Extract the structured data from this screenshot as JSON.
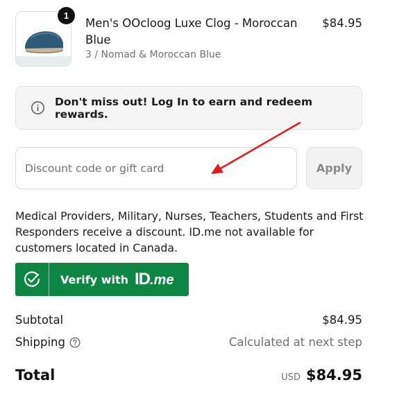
{
  "cart_item": {
    "quantity": "1",
    "name": "Men's OOcloog Luxe Clog - Moroccan Blue",
    "variant": "3 / Nomad & Moroccan Blue",
    "price": "$84.95",
    "image_icon": "blue-clog-shoe"
  },
  "login_banner": {
    "icon": "info-icon",
    "text": "Don't miss out! Log In to earn and redeem rewards."
  },
  "discount": {
    "placeholder": "Discount code or gift card",
    "value": "",
    "apply_label": "Apply"
  },
  "discount_info": "Medical Providers, Military, Nurses, Teachers, Students and First Responders receive a discount. ID.me not available for customers located in Canada.",
  "idme": {
    "label": "Verify with",
    "logo_id": "ID",
    "logo_me": ".me",
    "color": "#0b8643"
  },
  "summary": {
    "subtotal_label": "Subtotal",
    "subtotal_value": "$84.95",
    "shipping_label": "Shipping",
    "shipping_value": "Calculated at next step",
    "total_label": "Total",
    "currency": "USD",
    "total_value": "$84.95"
  },
  "annotation": {
    "color": "#e01b1b"
  }
}
